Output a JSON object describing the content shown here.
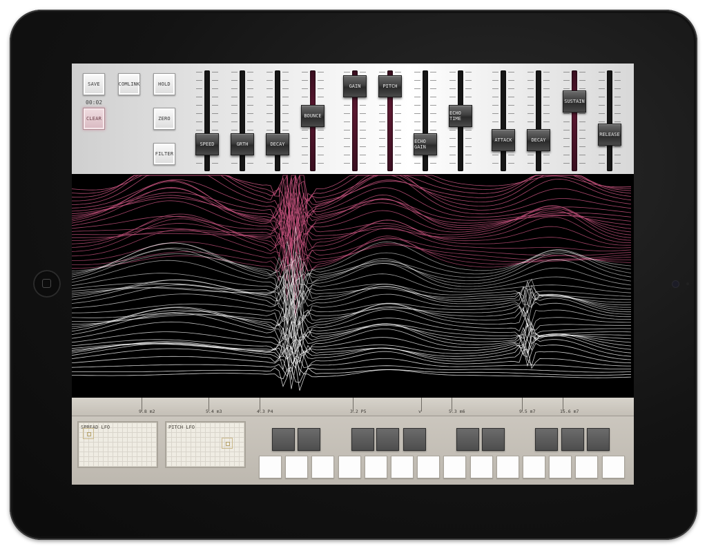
{
  "buttons": {
    "save": "SAVE",
    "comlink": "COMLINK",
    "hold": "HOLD",
    "clear": "CLEAR",
    "zero": "ZERO",
    "filter": "FILTER",
    "timer": "00:02"
  },
  "sliders": [
    {
      "label": "SPEED",
      "color": "dark",
      "value": 0.16
    },
    {
      "label": "GRTH",
      "color": "dark",
      "value": 0.16
    },
    {
      "label": "DECAY",
      "color": "dark",
      "value": 0.16
    },
    {
      "label": "BOUNCE",
      "color": "pink",
      "value": 0.56
    },
    {
      "label": "GAIN",
      "color": "pink",
      "value": 0.97
    },
    {
      "label": "PITCH",
      "color": "pink",
      "value": 0.97
    },
    {
      "label": "ECHO GAIN",
      "color": "dark",
      "value": 0.16
    },
    {
      "label": "ECHO TIME",
      "color": "dark",
      "value": 0.56
    },
    {
      "label": "ATTACK",
      "color": "dark",
      "value": 0.22
    },
    {
      "label": "DECAY",
      "color": "dark",
      "value": 0.22
    },
    {
      "label": "SUSTAIN",
      "color": "pink",
      "value": 0.76
    },
    {
      "label": "RELEASE",
      "color": "dark",
      "value": 0.3
    }
  ],
  "ruler": [
    {
      "label": "9.8 m2"
    },
    {
      "label": "5.4 m3"
    },
    {
      "label": "4.3 P4"
    },
    {
      "label": "3.2 P5"
    },
    {
      "label": "v"
    },
    {
      "label": "5.3 m6"
    },
    {
      "label": "9.5 m7"
    },
    {
      "label": "15.6 m7"
    }
  ],
  "lfo": {
    "spread": "SPREAD LFO",
    "pitch": "PITCH LFO"
  },
  "colors": {
    "accent_pink": "#c0507a",
    "wave_white": "#ffffff",
    "background": "#000000"
  },
  "icons": {
    "home": "home-button-icon",
    "camera": "camera-icon"
  }
}
